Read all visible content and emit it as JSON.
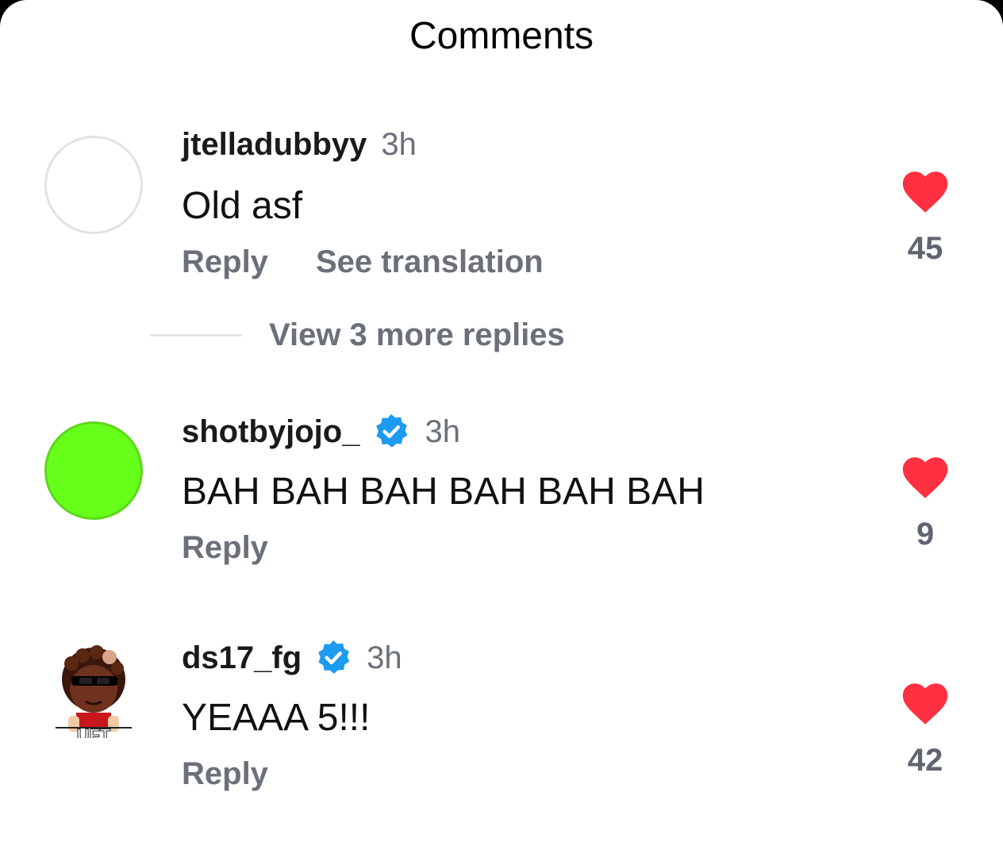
{
  "sheet": {
    "title": "Comments"
  },
  "comments": [
    {
      "username": "jtelladubbyy",
      "time": "3h",
      "text": "Old asf",
      "reply_label": "Reply",
      "translate_label": "See translation",
      "likes": "45",
      "view_replies": "View 3 more replies"
    },
    {
      "username": "shotbyjojo_",
      "time": "3h",
      "text": "BAH BAH BAH BAH BAH BAH",
      "reply_label": "Reply",
      "likes": "9"
    },
    {
      "username": "ds17_fg",
      "time": "3h",
      "text": "YEAAA 5!!!",
      "reply_label": "Reply",
      "likes": "42",
      "avatar_caption": "UFT"
    }
  ],
  "colors": {
    "like_heart": "#ff3040",
    "verified_badge": "#1d9bf0",
    "avatar_green": "#66ff1a",
    "muted_text": "#6b7079"
  },
  "icons": {
    "like": "heart-icon",
    "verified": "verified-badge-icon"
  }
}
